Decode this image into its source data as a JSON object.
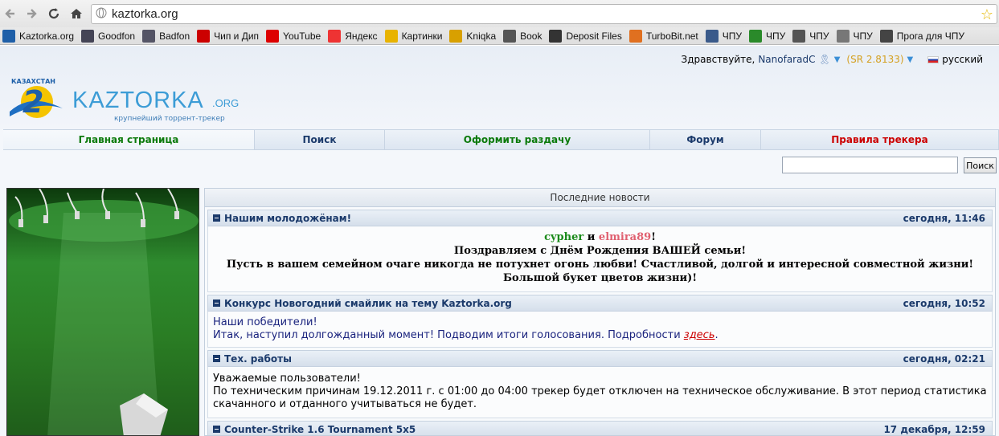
{
  "browser": {
    "url": "kaztorka.org",
    "bookmarks": [
      {
        "label": "Kaztorka.org",
        "icon": "k-icon",
        "color": "#1e5fa8"
      },
      {
        "label": "Goodfon",
        "icon": "monitor-icon",
        "color": "#445"
      },
      {
        "label": "Badfon",
        "icon": "badfon-icon",
        "color": "#556"
      },
      {
        "label": "Чип и Дип",
        "icon": "chip-icon",
        "color": "#c00"
      },
      {
        "label": "YouTube",
        "icon": "youtube-icon",
        "color": "#d00"
      },
      {
        "label": "Яндекс",
        "icon": "yandex-icon",
        "color": "#e33"
      },
      {
        "label": "Картинки",
        "icon": "images-icon",
        "color": "#e8b300"
      },
      {
        "label": "Kniqka",
        "icon": "star-icon",
        "color": "#d8a000"
      },
      {
        "label": "Book",
        "icon": "globe-icon",
        "color": "#555"
      },
      {
        "label": "Deposit Files",
        "icon": "deposit-icon",
        "color": "#333"
      },
      {
        "label": "TurboBit.net",
        "icon": "turbobit-icon",
        "color": "#e07020"
      },
      {
        "label": "ЧПУ",
        "icon": "h-icon",
        "color": "#3a5a8a"
      },
      {
        "label": "ЧПУ",
        "icon": "y-icon",
        "color": "#2a8a2a"
      },
      {
        "label": "ЧПУ",
        "icon": "globe-icon",
        "color": "#555"
      },
      {
        "label": "ЧПУ",
        "icon": "mail-icon",
        "color": "#777"
      },
      {
        "label": "Прога для ЧПУ",
        "icon": "gear-icon",
        "color": "#444"
      }
    ]
  },
  "header": {
    "greeting": "Здравствуйте,",
    "username": "NanofaradC",
    "rating": "(SR 2.8133)",
    "language": "русский",
    "logo_top": "КАЗАХСТАН",
    "logo_name": "KAZTORKA",
    "logo_tld": ".ORG",
    "logo_slogan": "крупнейший торрент-трекер"
  },
  "nav": [
    {
      "label": "Главная страница",
      "color": "#0b7a0b",
      "width": 313
    },
    {
      "label": "Поиск",
      "color": "#1b3a6b",
      "width": 162
    },
    {
      "label": "Оформить раздачу",
      "color": "#0b7a0b",
      "width": 330
    },
    {
      "label": "Форум",
      "color": "#1b3a6b",
      "width": 138
    },
    {
      "label": "Правила трекера",
      "color": "#cc0000",
      "width": 296
    }
  ],
  "search": {
    "button": "Поиск",
    "value": ""
  },
  "news": {
    "title": "Последние новости",
    "items": [
      {
        "title": "Нашим молодожёнам!",
        "date": "сегодня, 11:46",
        "names": {
          "a": "cypher",
          "and": " и ",
          "b": "elmira89",
          "end": "!"
        },
        "lines": [
          "Поздравляем с Днём Рождения ВАШЕЙ семьи!",
          "Пусть в вашем семейном очаге никогда не потухнет огонь любви! Счастливой, долгой и интересной совместной жизни!",
          "Большой букет цветов жизни)!"
        ]
      },
      {
        "title": "Конкурс Новогодний смайлик на тему Kaztorka.org",
        "date": "сегодня, 10:52",
        "lines": [
          "Наши победители!"
        ],
        "text": "Итак, наступил долгожданный момент! Подводим итоги голосования. Подробности ",
        "link": "здесь",
        "tail": "."
      },
      {
        "title": "Тех. работы",
        "date": "сегодня, 02:21",
        "lines": [
          "Уважаемые пользователи!",
          "По техническим причинам 19.12.2011 г. с 01:00 до 04:00 трекер будет отключен на техническое обслуживание. В этот период статистика скачанного и отданного учитываться не будет."
        ]
      },
      {
        "title": "Counter-Strike 1.6 Tournament 5x5",
        "date": "17 декабря, 12:59"
      }
    ]
  },
  "colors": {
    "green": "#1a8a1a",
    "pink": "#e06070",
    "link": "#cc0000"
  }
}
